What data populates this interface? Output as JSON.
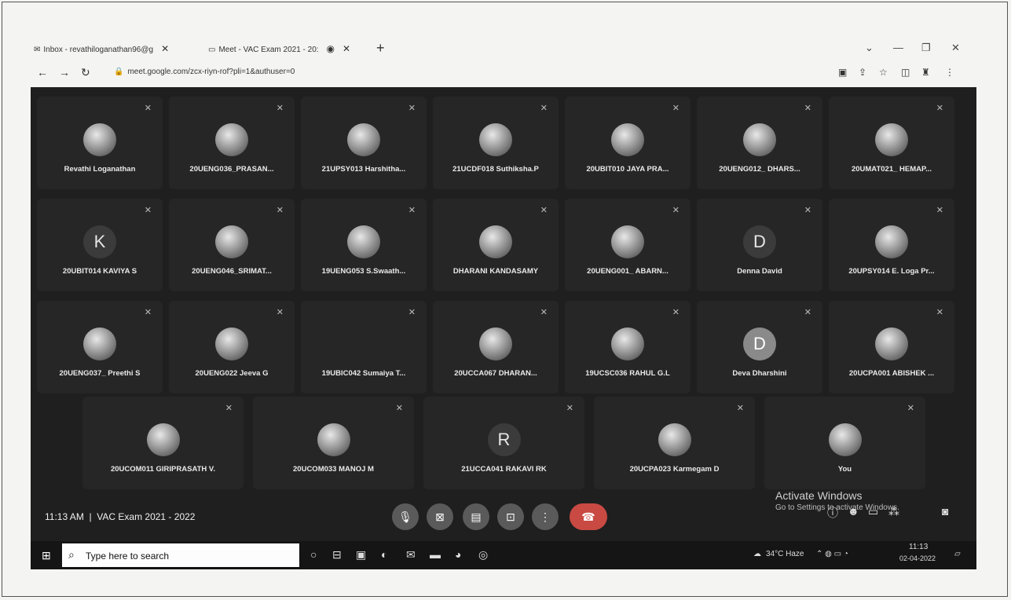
{
  "browser": {
    "tabs": [
      {
        "icon": "gmail-icon",
        "label": "Inbox - revathiloganathan96@g"
      },
      {
        "icon": "meet-icon",
        "label": "Meet - VAC Exam 2021 - 20:"
      }
    ],
    "url": "meet.google.com/zcx-riyn-rof?pli=1&authuser=0"
  },
  "participants": [
    {
      "name": "Revathi Loganathan",
      "avatar": "photo"
    },
    {
      "name": "20UENG036_PRASAN...",
      "avatar": "photo"
    },
    {
      "name": "21UPSY013 Harshitha...",
      "avatar": "photo"
    },
    {
      "name": "21UCDF018 Suthiksha.P",
      "avatar": "photo"
    },
    {
      "name": "20UBIT010 JAYA PRA...",
      "avatar": "photo"
    },
    {
      "name": "20UENG012_ DHARS...",
      "avatar": "photo"
    },
    {
      "name": "20UMAT021_ HEMAP...",
      "avatar": "photo"
    },
    {
      "name": "20UBIT014 KAVIYA S",
      "avatar": "letter",
      "letter": "K"
    },
    {
      "name": "20UENG046_SRIMAT...",
      "avatar": "photo"
    },
    {
      "name": "19UENG053 S.Swaath...",
      "avatar": "photo"
    },
    {
      "name": "DHARANI KANDASAMY",
      "avatar": "photo"
    },
    {
      "name": "20UENG001_ ABARN...",
      "avatar": "photo"
    },
    {
      "name": "Denna David",
      "avatar": "letter",
      "letter": "D"
    },
    {
      "name": "20UPSY014 E. Loga Pr...",
      "avatar": "photo"
    },
    {
      "name": "20UENG037_ Preethi S",
      "avatar": "photo"
    },
    {
      "name": "20UENG022 Jeeva G",
      "avatar": "photo"
    },
    {
      "name": "19UBIC042 Sumaiya T...",
      "avatar": "none"
    },
    {
      "name": "20UCCA067 DHARAN...",
      "avatar": "photo"
    },
    {
      "name": "19UCSC036 RAHUL G.L",
      "avatar": "photo"
    },
    {
      "name": "Deva Dharshini",
      "avatar": "letter",
      "letter": "D"
    },
    {
      "name": "20UCPA001 ABISHEK ...",
      "avatar": "photo"
    },
    {
      "name": "20UCOM011 GIRIPRASATH V.",
      "avatar": "photo"
    },
    {
      "name": "20UCOM033 MANOJ M",
      "avatar": "photo"
    },
    {
      "name": "21UCCA041 RAKAVI RK",
      "avatar": "letter",
      "letter": "R"
    },
    {
      "name": "20UCPA023 Karmegam D",
      "avatar": "photo"
    },
    {
      "name": "You",
      "avatar": "photo"
    }
  ],
  "meeting": {
    "time": "11:13 AM",
    "separator": "|",
    "title": "VAC Exam 2021 - 2022"
  },
  "watermark": {
    "line1": "Activate Windows",
    "line2": "Go to Settings to activate Windows."
  },
  "taskbar": {
    "search_placeholder": "Type here to search",
    "weather": "34°C  Haze",
    "clock_time": "11:13",
    "clock_date": "02-04-2022"
  }
}
